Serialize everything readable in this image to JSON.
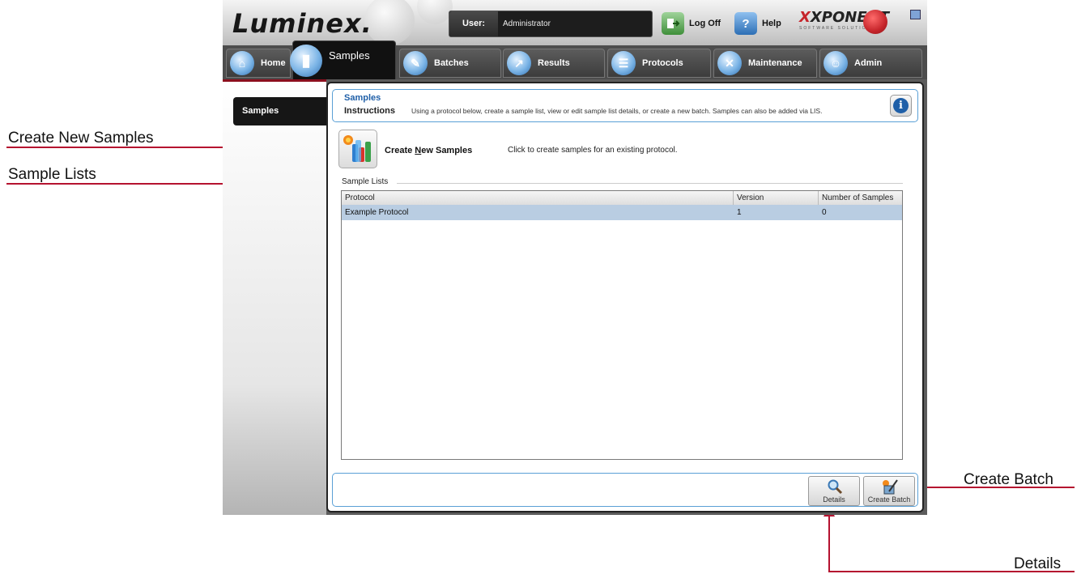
{
  "annotations": {
    "create_new_samples": "Create New Samples",
    "sample_lists": "Sample Lists",
    "create_batch": "Create Batch",
    "details": "Details"
  },
  "header": {
    "logo": "Luminex.",
    "user_label": "User:",
    "user_value": "Administrator",
    "log_off": "Log Off",
    "help": "Help",
    "product_logo": "XPONENT",
    "product_sub": "SOFTWARE SOLUTIONS"
  },
  "tabs": [
    {
      "label": "Home",
      "icon": "home-icon"
    },
    {
      "label": "Samples",
      "icon": "samples-icon"
    },
    {
      "label": "Batches",
      "icon": "batches-icon"
    },
    {
      "label": "Results",
      "icon": "results-icon"
    },
    {
      "label": "Protocols",
      "icon": "protocols-icon"
    },
    {
      "label": "Maintenance",
      "icon": "maintenance-icon"
    },
    {
      "label": "Admin",
      "icon": "admin-icon"
    }
  ],
  "active_tab": "Samples",
  "sidebar": {
    "items": [
      {
        "label": "Samples"
      }
    ]
  },
  "instructions": {
    "title": "Samples",
    "label": "Instructions",
    "text": "Using a protocol below, create a sample list, view or edit sample list details, or create a new batch. Samples can also be added via LIS."
  },
  "create_samples": {
    "label_pre": "Create ",
    "label_mnemonic": "N",
    "label_post": "ew Samples",
    "description": "Click to create samples for an existing protocol."
  },
  "sample_lists": {
    "group_label": "Sample Lists",
    "columns": [
      "Protocol",
      "Version",
      "Number of Samples"
    ],
    "rows": [
      {
        "protocol": "Example Protocol",
        "version": "1",
        "number_of_samples": "0"
      }
    ]
  },
  "actions": {
    "details": "Details",
    "create_batch": "Create Batch"
  },
  "colors": {
    "callout_red": "#b5122f",
    "accent_blue": "#1f5fa8",
    "selected_row": "#b9cde2"
  }
}
